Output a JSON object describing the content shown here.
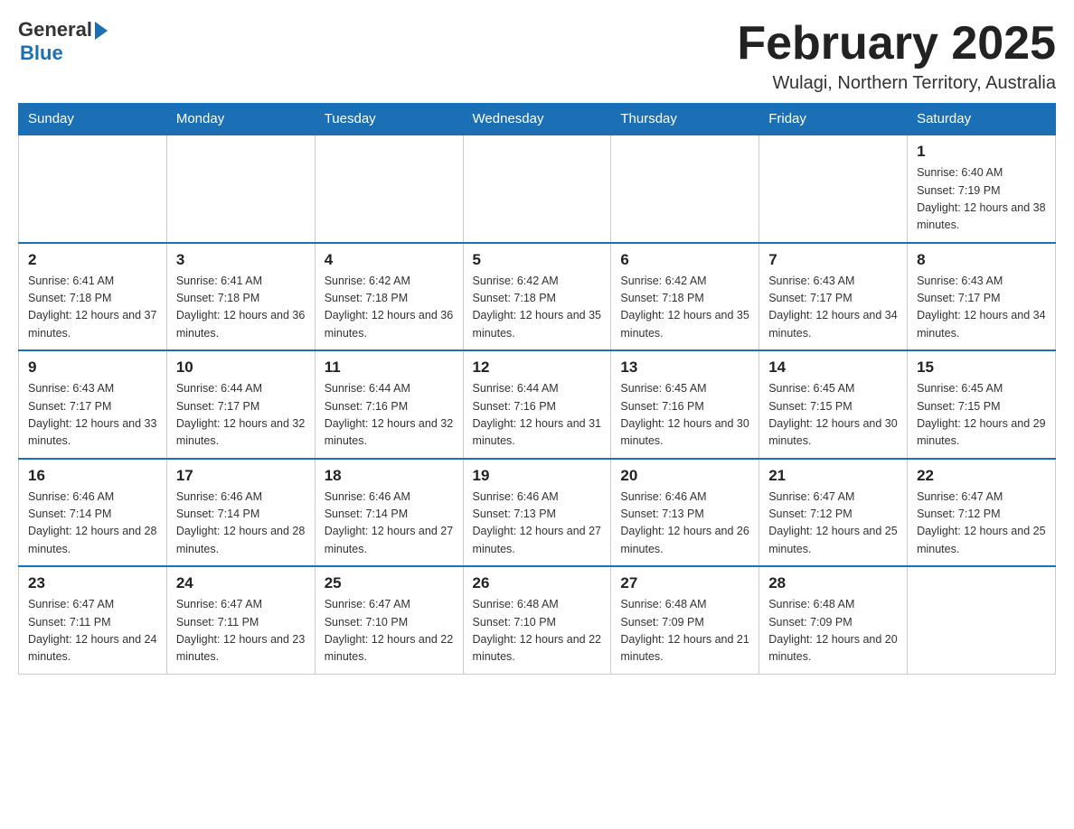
{
  "header": {
    "logo_general": "General",
    "logo_blue": "Blue",
    "month_title": "February 2025",
    "location": "Wulagi, Northern Territory, Australia"
  },
  "days_of_week": [
    "Sunday",
    "Monday",
    "Tuesday",
    "Wednesday",
    "Thursday",
    "Friday",
    "Saturday"
  ],
  "weeks": [
    [
      {
        "day": "",
        "info": ""
      },
      {
        "day": "",
        "info": ""
      },
      {
        "day": "",
        "info": ""
      },
      {
        "day": "",
        "info": ""
      },
      {
        "day": "",
        "info": ""
      },
      {
        "day": "",
        "info": ""
      },
      {
        "day": "1",
        "info": "Sunrise: 6:40 AM\nSunset: 7:19 PM\nDaylight: 12 hours and 38 minutes."
      }
    ],
    [
      {
        "day": "2",
        "info": "Sunrise: 6:41 AM\nSunset: 7:18 PM\nDaylight: 12 hours and 37 minutes."
      },
      {
        "day": "3",
        "info": "Sunrise: 6:41 AM\nSunset: 7:18 PM\nDaylight: 12 hours and 36 minutes."
      },
      {
        "day": "4",
        "info": "Sunrise: 6:42 AM\nSunset: 7:18 PM\nDaylight: 12 hours and 36 minutes."
      },
      {
        "day": "5",
        "info": "Sunrise: 6:42 AM\nSunset: 7:18 PM\nDaylight: 12 hours and 35 minutes."
      },
      {
        "day": "6",
        "info": "Sunrise: 6:42 AM\nSunset: 7:18 PM\nDaylight: 12 hours and 35 minutes."
      },
      {
        "day": "7",
        "info": "Sunrise: 6:43 AM\nSunset: 7:17 PM\nDaylight: 12 hours and 34 minutes."
      },
      {
        "day": "8",
        "info": "Sunrise: 6:43 AM\nSunset: 7:17 PM\nDaylight: 12 hours and 34 minutes."
      }
    ],
    [
      {
        "day": "9",
        "info": "Sunrise: 6:43 AM\nSunset: 7:17 PM\nDaylight: 12 hours and 33 minutes."
      },
      {
        "day": "10",
        "info": "Sunrise: 6:44 AM\nSunset: 7:17 PM\nDaylight: 12 hours and 32 minutes."
      },
      {
        "day": "11",
        "info": "Sunrise: 6:44 AM\nSunset: 7:16 PM\nDaylight: 12 hours and 32 minutes."
      },
      {
        "day": "12",
        "info": "Sunrise: 6:44 AM\nSunset: 7:16 PM\nDaylight: 12 hours and 31 minutes."
      },
      {
        "day": "13",
        "info": "Sunrise: 6:45 AM\nSunset: 7:16 PM\nDaylight: 12 hours and 30 minutes."
      },
      {
        "day": "14",
        "info": "Sunrise: 6:45 AM\nSunset: 7:15 PM\nDaylight: 12 hours and 30 minutes."
      },
      {
        "day": "15",
        "info": "Sunrise: 6:45 AM\nSunset: 7:15 PM\nDaylight: 12 hours and 29 minutes."
      }
    ],
    [
      {
        "day": "16",
        "info": "Sunrise: 6:46 AM\nSunset: 7:14 PM\nDaylight: 12 hours and 28 minutes."
      },
      {
        "day": "17",
        "info": "Sunrise: 6:46 AM\nSunset: 7:14 PM\nDaylight: 12 hours and 28 minutes."
      },
      {
        "day": "18",
        "info": "Sunrise: 6:46 AM\nSunset: 7:14 PM\nDaylight: 12 hours and 27 minutes."
      },
      {
        "day": "19",
        "info": "Sunrise: 6:46 AM\nSunset: 7:13 PM\nDaylight: 12 hours and 27 minutes."
      },
      {
        "day": "20",
        "info": "Sunrise: 6:46 AM\nSunset: 7:13 PM\nDaylight: 12 hours and 26 minutes."
      },
      {
        "day": "21",
        "info": "Sunrise: 6:47 AM\nSunset: 7:12 PM\nDaylight: 12 hours and 25 minutes."
      },
      {
        "day": "22",
        "info": "Sunrise: 6:47 AM\nSunset: 7:12 PM\nDaylight: 12 hours and 25 minutes."
      }
    ],
    [
      {
        "day": "23",
        "info": "Sunrise: 6:47 AM\nSunset: 7:11 PM\nDaylight: 12 hours and 24 minutes."
      },
      {
        "day": "24",
        "info": "Sunrise: 6:47 AM\nSunset: 7:11 PM\nDaylight: 12 hours and 23 minutes."
      },
      {
        "day": "25",
        "info": "Sunrise: 6:47 AM\nSunset: 7:10 PM\nDaylight: 12 hours and 22 minutes."
      },
      {
        "day": "26",
        "info": "Sunrise: 6:48 AM\nSunset: 7:10 PM\nDaylight: 12 hours and 22 minutes."
      },
      {
        "day": "27",
        "info": "Sunrise: 6:48 AM\nSunset: 7:09 PM\nDaylight: 12 hours and 21 minutes."
      },
      {
        "day": "28",
        "info": "Sunrise: 6:48 AM\nSunset: 7:09 PM\nDaylight: 12 hours and 20 minutes."
      },
      {
        "day": "",
        "info": ""
      }
    ]
  ]
}
